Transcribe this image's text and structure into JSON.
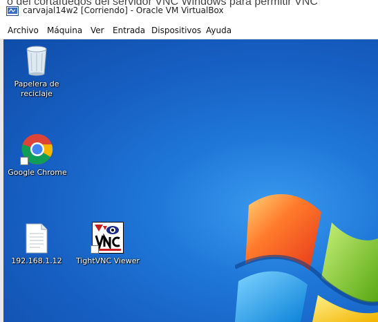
{
  "window": {
    "background_text": "o del cortafuegos del servidor VNC Windows para permitir VNC",
    "title": "carvajal14w2 [Corriendo] - Oracle VM VirtualBox"
  },
  "menu": [
    "Archivo",
    "Máquina",
    "Ver",
    "Entrada",
    "Dispositivos",
    "Ayuda"
  ],
  "desktop": {
    "icons": [
      {
        "label_1": "Papelera de",
        "label_2": "reciclaje",
        "icon": "recycle-bin-icon"
      },
      {
        "label": "Google Chrome",
        "icon": "chrome-icon"
      },
      {
        "label": "192.168.1.12",
        "icon": "text-file-icon"
      },
      {
        "label": "TightVNC Viewer",
        "icon": "tightvnc-icon"
      }
    ]
  },
  "colors": {
    "desktop_blue": "#1a67c9",
    "logo_red": "#f25022",
    "logo_green": "#7fba00",
    "logo_blue": "#00a4ef",
    "logo_yellow": "#ffb900"
  }
}
